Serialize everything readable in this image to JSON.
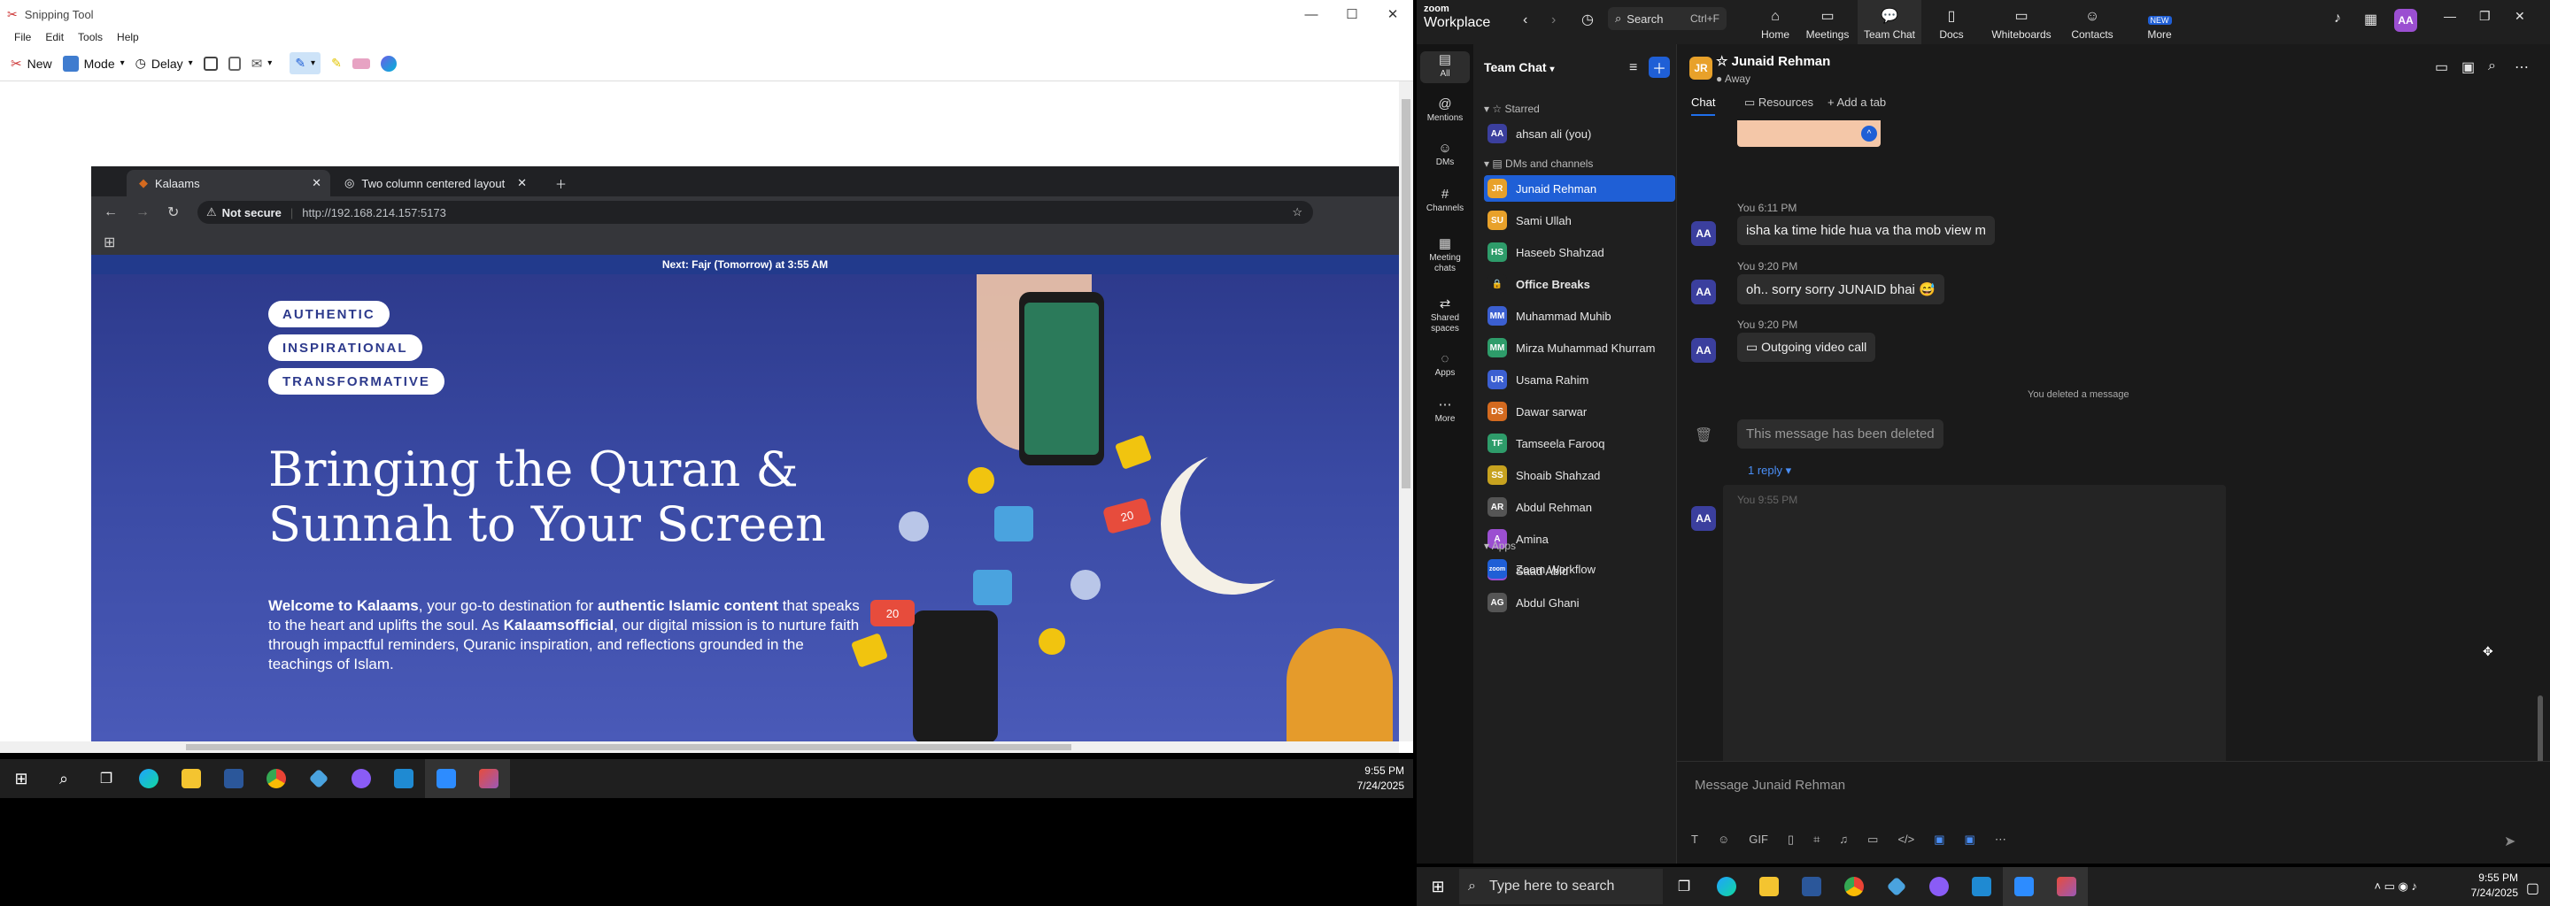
{
  "snipping_tool": {
    "title": "Snipping Tool",
    "menu": [
      "File",
      "Edit",
      "Tools",
      "Help"
    ],
    "toolbar": {
      "new_label": "New",
      "mode_label": "Mode",
      "delay_label": "Delay"
    },
    "captured_browser": {
      "tabs": [
        "Kalaams",
        "Two column centered layout"
      ],
      "security_label": "Not secure",
      "url": "http://192.168.214.157:5173",
      "banner": "Next: Fajr (Tomorrow) at 3:55 AM",
      "badges": [
        "AUTHENTIC",
        "INSPIRATIONAL",
        "TRANSFORMATIVE"
      ],
      "hero_title": "Bringing the Quran & Sunnah to Your Screen",
      "hero_text_parts": {
        "p1": "Welcome to ",
        "b1": "Kalaams",
        "p2": ", your go-to destination for ",
        "b2": "authentic Islamic content",
        "p3": " that speaks to the heart and uplifts the soul. As ",
        "b3": "Kalaamsofficial",
        "p4": ", our digital mission is to nurture faith through impactful reminders, Quranic inspiration, and reflections grounded in the teachings of Islam."
      },
      "sticker_labels": [
        "20",
        "20"
      ]
    }
  },
  "left_taskbar": {
    "time": "9:55 PM",
    "date": "7/24/2025"
  },
  "zoom": {
    "brand": {
      "line1": "zoom",
      "line2": "Workplace"
    },
    "search": {
      "label": "Search",
      "shortcut": "Ctrl+F"
    },
    "nav": [
      "Home",
      "Meetings",
      "Team Chat",
      "Docs",
      "Whiteboards",
      "Contacts",
      "More"
    ],
    "nav_new_badge": "NEW",
    "user_initials": "AA",
    "rail": [
      "All",
      "Mentions",
      "DMs",
      "Channels",
      "Meeting chats",
      "Shared spaces",
      "Apps",
      "More"
    ],
    "list_title": "Team Chat",
    "sections": {
      "starred": "Starred",
      "dms": "DMs and channels",
      "apps": "Apps"
    },
    "starred": [
      {
        "name": "ahsan ali (you)",
        "initials": "AA",
        "color": "#3b3f9e"
      }
    ],
    "contacts": [
      {
        "name": "Junaid Rehman",
        "initials": "JR",
        "color": "#e8a12a",
        "selected": true
      },
      {
        "name": "Sami Ullah",
        "initials": "SU",
        "color": "#e8a12a"
      },
      {
        "name": "Haseeb Shahzad",
        "initials": "HS",
        "color": "#2e9c6a"
      },
      {
        "name": "Office Breaks",
        "initials": "🔒",
        "color": "#1f1f1f",
        "bold": true
      },
      {
        "name": "Muhammad Muhib",
        "initials": "MM",
        "color": "#3b5fd1"
      },
      {
        "name": "Mirza Muhammad Khurram",
        "initials": "MM",
        "color": "#2e9c6a"
      },
      {
        "name": "Usama Rahim",
        "initials": "UR",
        "color": "#3b5fd1"
      },
      {
        "name": "Dawar sarwar",
        "initials": "DS",
        "color": "#d46a1f"
      },
      {
        "name": "Tamseela Farooq",
        "initials": "TF",
        "color": "#2e9c6a"
      },
      {
        "name": "Shoaib Shahzad",
        "initials": "SS",
        "color": "#c7a21f"
      },
      {
        "name": "Abdul Rehman",
        "initials": "AR",
        "color": "#555"
      },
      {
        "name": "Amina",
        "initials": "A",
        "color": "#9b4fd1"
      },
      {
        "name": "Saad Abid",
        "initials": "SA",
        "color": "#9b4fd1"
      },
      {
        "name": "Abdul Ghani",
        "initials": "AG",
        "color": "#555"
      }
    ],
    "apps": [
      {
        "name": "Zoom Workflow",
        "initials": "zoom",
        "color": "#1f5fd6"
      }
    ],
    "chat": {
      "name": "Junaid Rehman",
      "initials": "JR",
      "status": "Away",
      "tabs": [
        "Chat",
        "Resources",
        "Add a tab"
      ],
      "messages": [
        {
          "meta": "You 6:11 PM",
          "text": "isha ka time hide hua va tha mob view m"
        },
        {
          "meta": "You 9:20 PM",
          "text": "oh.. sorry sorry JUNAID bhai 😅"
        },
        {
          "meta": "You 9:20 PM",
          "text": "Outgoing video call"
        }
      ],
      "deleted_notice": "You deleted a message",
      "deleted_text": "This message has been deleted",
      "reply_label": "1 reply",
      "last_meta": "You 9:55 PM",
      "compose_placeholder": "Message Junaid Rehman"
    }
  },
  "right_taskbar": {
    "search_placeholder": "Type here to search",
    "time": "9:55 PM",
    "date": "7/24/2025"
  }
}
